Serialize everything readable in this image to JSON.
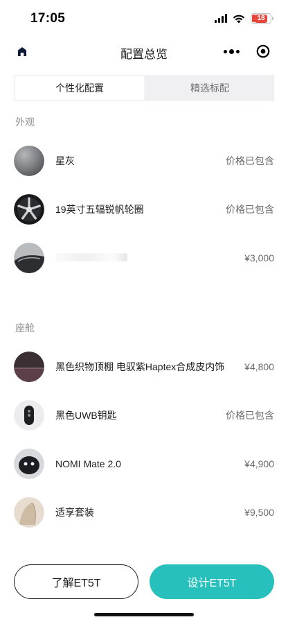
{
  "status_bar": {
    "time": "17:05",
    "battery": "18"
  },
  "nav": {
    "title": "配置总览"
  },
  "tabs": [
    {
      "label": "个性化配置",
      "active": true
    },
    {
      "label": "精选标配",
      "active": false
    }
  ],
  "sections": [
    {
      "title": "外观",
      "items": [
        {
          "name": "星灰",
          "price": "价格已包含",
          "thumb": "grey-paint"
        },
        {
          "name": "19英寸五辐锐帆轮圈",
          "price": "价格已包含",
          "thumb": "wheel"
        },
        {
          "name": "",
          "price": "¥3,000",
          "thumb": "roof"
        }
      ]
    },
    {
      "title": "座舱",
      "items": [
        {
          "name": "黑色织物顶棚 电驭紫Haptex合成皮内饰",
          "price": "¥4,800",
          "thumb": "interior"
        },
        {
          "name": "黑色UWB钥匙",
          "price": "价格已包含",
          "thumb": "key"
        },
        {
          "name": "NOMI Mate 2.0",
          "price": "¥4,900",
          "thumb": "nomi"
        },
        {
          "name": "适享套装",
          "price": "¥9,500",
          "thumb": "seat"
        }
      ]
    }
  ],
  "buttons": {
    "learn": "了解ET5T",
    "design": "设计ET5T"
  },
  "colors": {
    "primary": "#27c0bd",
    "text": "#1c1c1e",
    "muted": "#8e8e93",
    "battery_low": "#e7453a"
  },
  "icons": [
    "home-icon",
    "more-icon",
    "target-icon",
    "wifi-icon",
    "signal-icon",
    "battery-icon"
  ]
}
